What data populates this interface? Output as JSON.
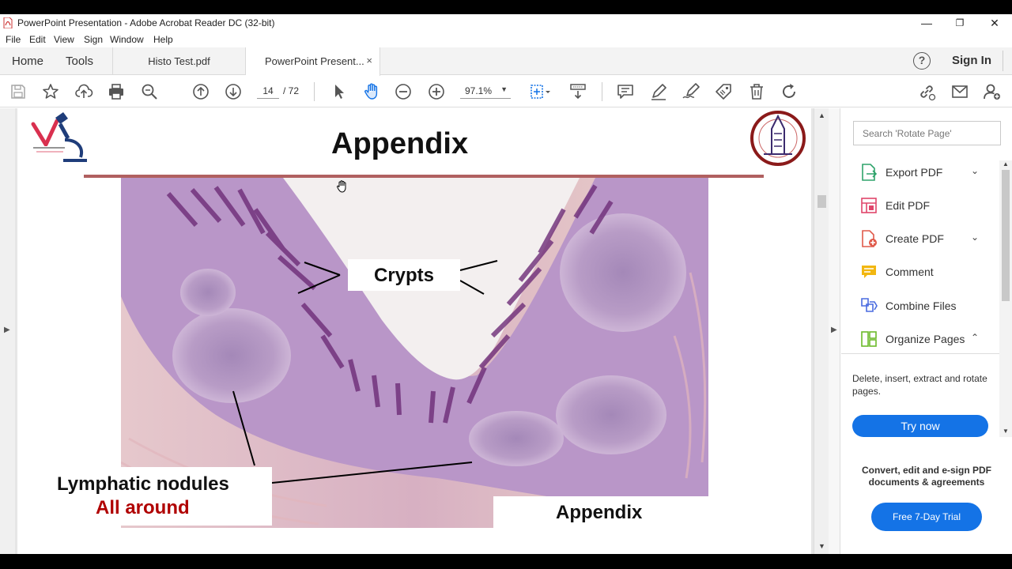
{
  "window": {
    "title": "PowerPoint Presentation - Adobe Acrobat Reader DC (32-bit)",
    "minimize": "—",
    "maximize": "❐",
    "close": "✕"
  },
  "menu": [
    "File",
    "Edit",
    "View",
    "Sign",
    "Window",
    "Help"
  ],
  "tabs": {
    "home": "Home",
    "tools": "Tools",
    "documents": [
      {
        "label": "Histo Test.pdf"
      },
      {
        "label": "PowerPoint Present...",
        "close": "×"
      }
    ],
    "help": "?",
    "sign_in": "Sign In"
  },
  "toolbar": {
    "page_current": "14",
    "page_total": "/  72",
    "zoom": "97.1%",
    "zoom_caret": "▼"
  },
  "slide": {
    "title": "Appendix",
    "label_crypts": "Crypts",
    "label_lymph_line1": "Lymphatic nodules",
    "label_lymph_line2": "All around",
    "label_appendix": "Appendix"
  },
  "right_panel": {
    "search_placeholder": "Search 'Rotate Page'",
    "tools": [
      {
        "label": "Export PDF",
        "chevron": "⌄",
        "icon": "export-pdf-icon",
        "color": "#2fa36b"
      },
      {
        "label": "Edit PDF",
        "chevron": "",
        "icon": "edit-pdf-icon",
        "color": "#e0466b"
      },
      {
        "label": "Create PDF",
        "chevron": "⌄",
        "icon": "create-pdf-icon",
        "color": "#e05a4a"
      },
      {
        "label": "Comment",
        "chevron": "",
        "icon": "comment-icon",
        "color": "#f2b711"
      },
      {
        "label": "Combine Files",
        "chevron": "",
        "icon": "combine-files-icon",
        "color": "#4a6ce0"
      },
      {
        "label": "Organize Pages",
        "chevron": "⌃",
        "icon": "organize-pages-icon",
        "color": "#6cba2a"
      }
    ],
    "description": "Delete, insert, extract and rotate pages.",
    "try_now": "Try now",
    "promo": "Convert, edit and e-sign PDF documents & agreements",
    "trial": "Free 7-Day Trial"
  },
  "colors": {
    "accent_blue": "#1473e6",
    "title_rule": "#b06060",
    "label_red": "#b00000"
  }
}
